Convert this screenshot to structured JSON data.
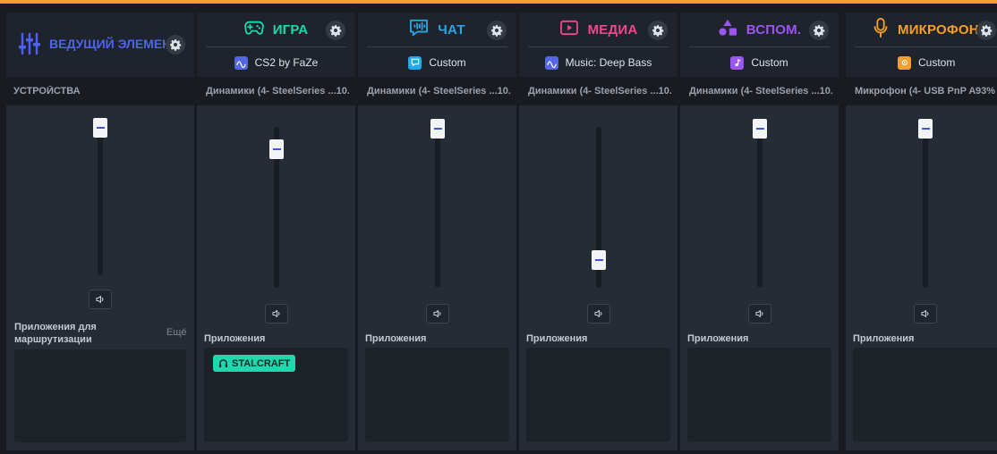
{
  "master": {
    "title": "ВЕДУЩИЙ ЭЛЕМЕНТ",
    "section_label": "УСТРОЙСТВА",
    "volume": 1.0,
    "apps_label": "Приложения для маршрутизации",
    "more_label": "Ещё",
    "color": "#4d63ef"
  },
  "channels": [
    {
      "title": "ИГРА",
      "color": "#1ed9ad",
      "icon": "gamepad-icon",
      "preset": "CS2 by FaZe",
      "preset_color": "#5466e8",
      "device": "Динамики (4- SteelSeries ...10...",
      "volume": 0.87,
      "apps_label": "Приложения",
      "apps": [
        "STALCRAFT"
      ]
    },
    {
      "title": "ЧАТ",
      "color": "#27a6e8",
      "icon": "chat-icon",
      "preset": "Custom",
      "preset_color": "#27a6e8",
      "device": "Динамики (4- SteelSeries ...10...",
      "volume": 1.0,
      "apps_label": "Приложения",
      "apps": []
    },
    {
      "title": "МЕДИА",
      "color": "#f0488f",
      "icon": "media-icon",
      "preset": "Music: Deep Bass",
      "preset_color": "#5466e8",
      "device": "Динамики (4- SteelSeries ...10...",
      "volume": 0.2,
      "apps_label": "Приложения",
      "apps": []
    },
    {
      "title": "ВСПОМ.",
      "color": "#9b55f0",
      "icon": "shapes-icon",
      "preset": "Custom",
      "preset_color": "#9b55f0",
      "device": "Динамики (4- SteelSeries ...10...",
      "volume": 1.0,
      "apps_label": "Приложения",
      "apps": []
    },
    {
      "title": "МИКРОФОН",
      "color": "#f5a02a",
      "icon": "mic-icon",
      "preset": "Custom",
      "preset_color": "#f5a02a",
      "device": "Микрофон (4- USB PnP A...",
      "device_pct": "93%",
      "volume": 0.93,
      "apps_label": "Приложения",
      "apps": []
    }
  ]
}
